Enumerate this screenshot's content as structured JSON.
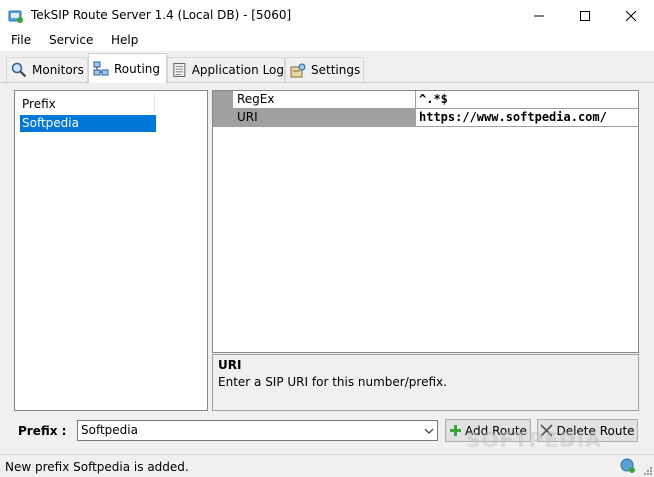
{
  "window": {
    "title": "TekSIP Route Server 1.4 (Local DB) - [5060]",
    "icon": "teksip-app-icon"
  },
  "menu": {
    "items": [
      {
        "label": "File"
      },
      {
        "label": "Service"
      },
      {
        "label": "Help"
      }
    ]
  },
  "tabs": [
    {
      "label": "Monitors",
      "icon": "magnifier-icon",
      "active": false
    },
    {
      "label": "Routing",
      "icon": "network-icon",
      "active": true
    },
    {
      "label": "Application Log",
      "icon": "log-icon",
      "active": false
    },
    {
      "label": "Settings",
      "icon": "settings-icon",
      "active": false
    }
  ],
  "prefix_list": {
    "header": "Prefix",
    "items": [
      {
        "label": "Softpedia",
        "selected": true
      }
    ]
  },
  "property_grid": {
    "rows": [
      {
        "name": "RegEx",
        "value": "^.*$",
        "selected": false
      },
      {
        "name": "URI",
        "value": "https://www.softpedia.com/",
        "selected": true
      }
    ]
  },
  "help": {
    "title": "URI",
    "description": "Enter a SIP URI for this number/prefix."
  },
  "footer": {
    "prefix_label": "Prefix :",
    "prefix_value": "Softpedia",
    "add_route_label": "Add Route",
    "delete_route_label": "Delete Route"
  },
  "status": {
    "text": "New prefix Softpedia is added."
  },
  "watermark": "SOFTPEDIA",
  "colors": {
    "selection": "#0078d7",
    "grid_margin": "#a0a0a0",
    "add_icon": "#3aa33a"
  }
}
